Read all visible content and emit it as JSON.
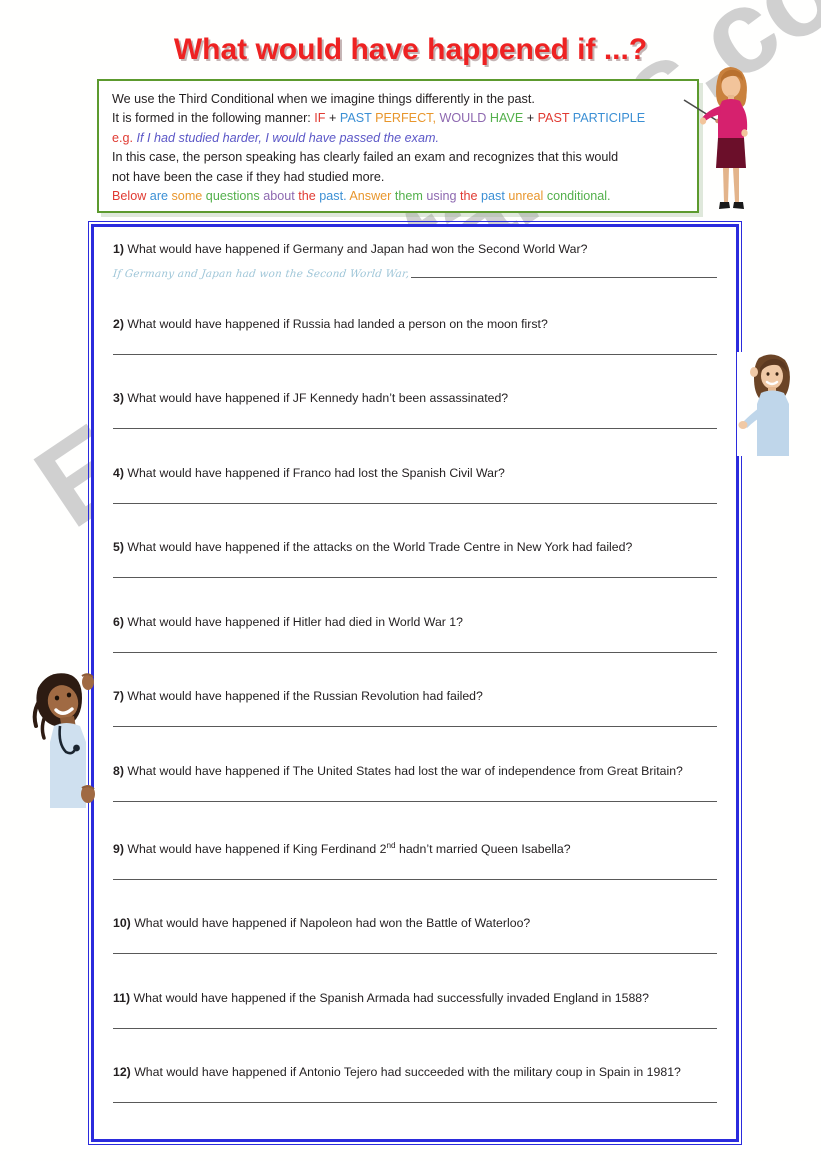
{
  "title": "What would have happened if ...?",
  "intro": {
    "line1": "We use the Third Conditional when we imagine things differently in the past.",
    "line2_prefix": "It is formed in the following manner:",
    "formula": [
      {
        "text": "IF",
        "color": "red"
      },
      {
        "text": "+",
        "color": "plain"
      },
      {
        "text": "PAST",
        "color": "blue"
      },
      {
        "text": "PERFECT,",
        "color": "orange"
      },
      {
        "text": "WOULD",
        "color": "purple"
      },
      {
        "text": "HAVE",
        "color": "green"
      },
      {
        "text": "+",
        "color": "plain"
      },
      {
        "text": "PAST",
        "color": "red"
      },
      {
        "text": "PARTICIPLE",
        "color": "blue"
      }
    ],
    "eg_label": "e.g.",
    "eg_text": "If I had studied harder, I would have passed the exam.",
    "line4": "In this case, the person speaking has clearly failed an exam and recognizes that this would",
    "line5": "not have been the case if they had studied more.",
    "line6": [
      {
        "text": "Below",
        "color": "red"
      },
      {
        "text": "are",
        "color": "blue"
      },
      {
        "text": "some",
        "color": "orange"
      },
      {
        "text": "questions",
        "color": "green"
      },
      {
        "text": "about",
        "color": "purple"
      },
      {
        "text": "the",
        "color": "red"
      },
      {
        "text": "past.",
        "color": "blue"
      },
      {
        "text": "Answer",
        "color": "orange"
      },
      {
        "text": "them",
        "color": "green"
      },
      {
        "text": "using",
        "color": "purple"
      },
      {
        "text": "the",
        "color": "red"
      },
      {
        "text": "past",
        "color": "blue"
      },
      {
        "text": "unreal",
        "color": "orange"
      },
      {
        "text": "conditional.",
        "color": "green"
      }
    ]
  },
  "questions": [
    {
      "num": "1)",
      "text": "What would have happened if Germany and Japan had won the Second World War?",
      "hint": "If Germany and Japan had won the Second World War,"
    },
    {
      "num": "2)",
      "text": "What would have happened if Russia had landed a person on the moon first?"
    },
    {
      "num": "3)",
      "text": "What would have happened if JF Kennedy hadn’t been assassinated?"
    },
    {
      "num": "4)",
      "text": "What would have happened if Franco had lost the Spanish Civil War?"
    },
    {
      "num": "5)",
      "text": "What would have happened if the attacks on the World Trade Centre in New York had failed?"
    },
    {
      "num": "6)",
      "text": "What would have happened if Hitler had died in World War 1?"
    },
    {
      "num": "7)",
      "text": "What would have happened if the Russian Revolution had failed?"
    },
    {
      "num": "8)",
      "text": "What would have happened if The United States had lost the war of independence from Great Britain?"
    },
    {
      "num": "9)",
      "text_pre": "What would have happened if King Ferdinand 2",
      "sup": "nd",
      "text_post": " hadn’t married Queen Isabella?"
    },
    {
      "num": "10)",
      "text": "What would have happened if Napoleon had won the Battle of Waterloo?"
    },
    {
      "num": "11)",
      "text": "What would have happened if the Spanish Armada had successfully invaded England in 1588?"
    },
    {
      "num": "12)",
      "text": "What would have happened if Antonio Tejero had succeeded with the military coup in Spain in 1981?"
    }
  ],
  "watermark": "ESLprintables.com",
  "colors": {
    "title": "#ee2222",
    "intro_border": "#5c9a2e",
    "main_border": "#2b2bdd",
    "answer_line": "#595959",
    "hint_text": "#9fc6d8",
    "watermark": "#c8c8c8"
  }
}
